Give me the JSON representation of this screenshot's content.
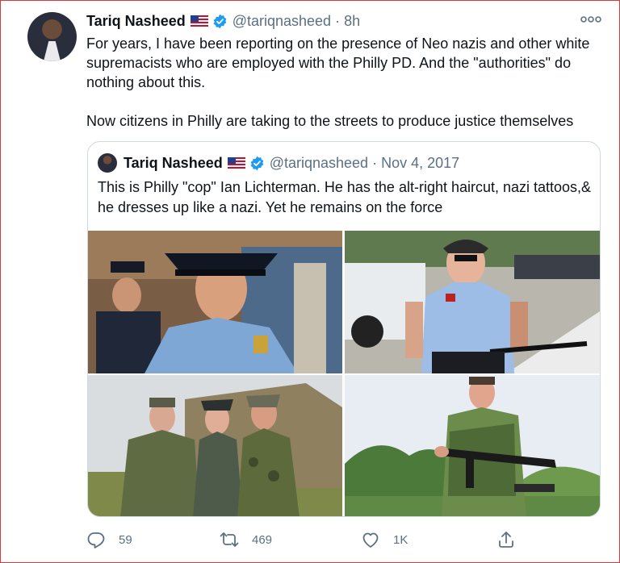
{
  "tweet": {
    "author_name": "Tariq Nasheed",
    "flag_icon": "us-flag-icon",
    "verified_icon": "verified-badge-icon",
    "handle_time": "@tariqnasheed · 8h",
    "text": "For years, I have been reporting on the presence of Neo nazis and other white supremacists who are employed with the Philly PD. And the \"authorities\" do nothing about this.\n\nNow citizens in Philly are taking to the streets to produce justice themselves",
    "more_icon": "more-dots-icon"
  },
  "quoted_tweet": {
    "author_name": "Tariq Nasheed",
    "handle_time": "@tariqnasheed · Nov 4, 2017",
    "text": "This is Philly \"cop\"   Ian Lichterman. He has the alt-right haircut, nazi tattoos,& he dresses up like a nazi. Yet he remains on the force",
    "images": [
      {
        "semantic": "police-officer-crowd-photo"
      },
      {
        "semantic": "police-officer-bicycle-photo"
      },
      {
        "semantic": "ww2-uniform-reenactors-photo"
      },
      {
        "semantic": "man-with-rifle-field-photo"
      }
    ]
  },
  "actions": {
    "reply_count": "59",
    "retweet_count": "469",
    "like_count": "1K"
  },
  "colors": {
    "accent": "#1d9bf0",
    "secondary_text": "#5b7083",
    "border": "#cfd9de",
    "frame": "#d93a3a"
  }
}
